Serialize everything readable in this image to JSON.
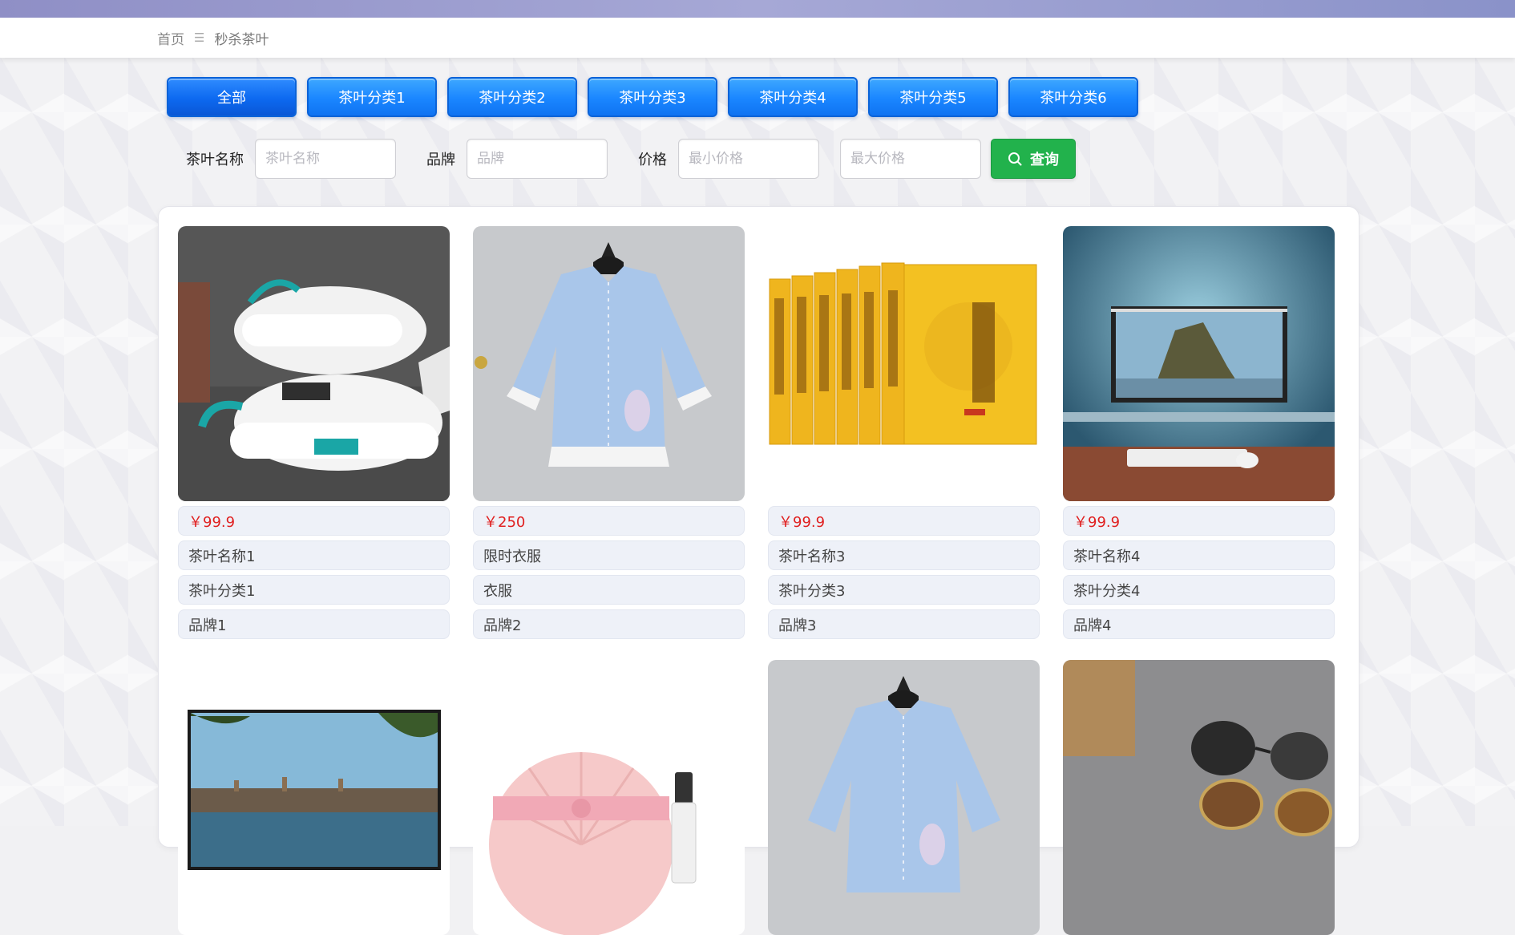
{
  "breadcrumb": {
    "home": "首页",
    "separator": "☰",
    "current": "秒杀茶叶"
  },
  "categories": [
    "全部",
    "茶叶分类1",
    "茶叶分类2",
    "茶叶分类3",
    "茶叶分类4",
    "茶叶分类5",
    "茶叶分类6"
  ],
  "search": {
    "name_label": "茶叶名称",
    "name_placeholder": "茶叶名称",
    "brand_label": "品牌",
    "brand_placeholder": "品牌",
    "price_label": "价格",
    "min_placeholder": "最小价格",
    "max_placeholder": "最大价格",
    "button_label": "查询"
  },
  "products": [
    {
      "image": "sneakers",
      "price": "￥99.9",
      "name": "茶叶名称1",
      "category": "茶叶分类1",
      "brand": "品牌1"
    },
    {
      "image": "blue-blouse",
      "price": "￥250",
      "name": "限时衣服",
      "category": "衣服",
      "brand": "品牌2"
    },
    {
      "image": "yellow-books",
      "price": "￥99.9",
      "name": "茶叶名称3",
      "category": "茶叶分类3",
      "brand": "品牌3"
    },
    {
      "image": "desk-monitor",
      "price": "￥99.9",
      "name": "茶叶名称4",
      "category": "茶叶分类4",
      "brand": "品牌4"
    },
    {
      "image": "tv-landscape"
    },
    {
      "image": "pink-cushion"
    },
    {
      "image": "blue-blouse"
    },
    {
      "image": "sunglasses"
    }
  ],
  "colors": {
    "primary": "#1a86ff",
    "search": "#22b24c",
    "price": "#e02020"
  }
}
